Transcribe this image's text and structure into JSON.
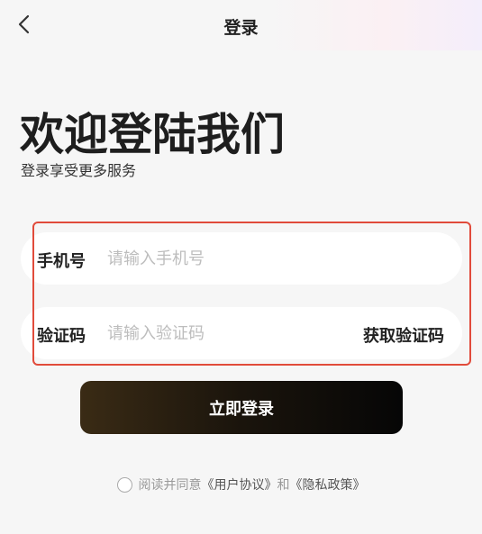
{
  "nav": {
    "title": "登录",
    "back_icon": "chevron-left-icon"
  },
  "hero": {
    "title": "欢迎登陆我们",
    "subtitle": "登录享受更多服务"
  },
  "form": {
    "phone": {
      "label": "手机号",
      "placeholder": "请输入手机号",
      "value": ""
    },
    "code": {
      "label": "验证码",
      "placeholder": "请输入验证码",
      "value": "",
      "action_label": "获取验证码"
    },
    "highlight_color": "#e14b3b"
  },
  "login_button": {
    "label": "立即登录"
  },
  "agreement": {
    "checked": false,
    "prefix": "阅读并同意",
    "user_agreement": "《用户协议》",
    "conjunction": "和",
    "privacy_policy": "《隐私政策》"
  }
}
